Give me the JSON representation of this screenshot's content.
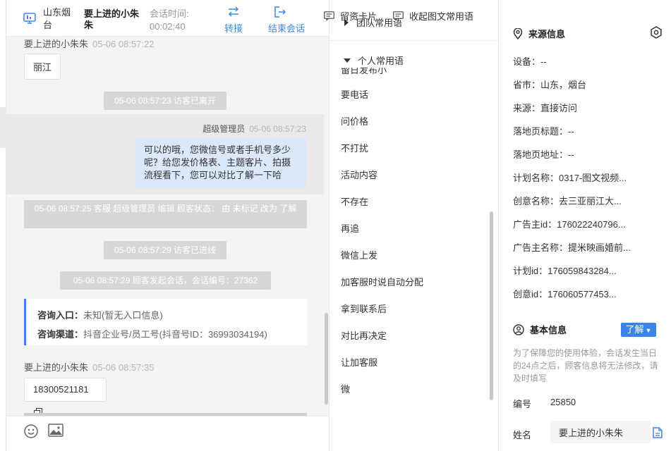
{
  "header": {
    "region": "山东烟台",
    "visitor_name": "要上进的小朱朱",
    "session_time_label": "会话时间:",
    "session_time": "00:02:40",
    "transfer_label": "转接",
    "end_label": "结束会话"
  },
  "messages": {
    "visitor_sender_1": "要上进的小朱朱",
    "visitor_time_1": "05-06 08:57:22",
    "visitor_text_1": "丽江",
    "sys_left": "05-06 08:57:23 访客已离开",
    "agent_sender": "超级管理员",
    "agent_time": "05-06 08:57:23",
    "agent_text": "可以的哦，您微信号或者手机号多少呢？给您发价格表、主题客片、拍摄流程看下，您可以对比了解一下哈",
    "sys_edit": "05-06 08:57:25 客服 超级管理员 编辑 顾客状态： 由 未标记 改为 了解",
    "sys_enter": "05-06 08:57:29 访客已进线",
    "sys_session": "05-06 08:57:29 顾客发起会话，会话编号：27362",
    "entry_label": "咨询入口：",
    "entry_value": "未知(暂无入口信息)",
    "channel_label": "咨询渠道：",
    "channel_value": "抖音企业号/员工号(抖音号ID：36993034194)",
    "visitor_sender_2": "要上进的小朱朱",
    "visitor_time_2": "05-06 08:57:35",
    "visitor_phone": "18300521181"
  },
  "footer": {
    "emoji_icon": "emoji-icon",
    "image_icon": "image-icon",
    "card_label": "留资卡片",
    "collect_label": "收起图文常用语"
  },
  "phrases": {
    "team_label": "团队常用语",
    "mine_label": "个人常用语",
    "cut_item": "留日发布小",
    "items": [
      "要电话",
      "问价格",
      "不打扰",
      "活动内容",
      "不存在",
      "再追",
      "微信上发",
      "加客服时说自动分配",
      "拿到联系后",
      "对比再决定",
      "让加客服",
      "微"
    ]
  },
  "side": {
    "source_title": "来源信息",
    "device": "设备：--",
    "province": "省市：山东，烟台",
    "source": "来源：直接访问",
    "landing_title": "落地页标题：--",
    "landing_url": "落地页地址：--",
    "plan_name": "计划名称：0317-图文视频...",
    "creative_name": "创意名称：去三亚丽江大...",
    "advertiser_id": "广告主id：176022240796...",
    "advertiser_name": "广告主名称：提米映画婚前...",
    "plan_id": "计划id：176059843284...",
    "creative_id": "创意id：176060577453...",
    "basic_title": "基本信息",
    "learn_label": "了解",
    "notice": "为了保障您的使用体验，会话发生当日的24点之后，顾客信息将无法修改，请及时填写",
    "number_label": "编号",
    "number_value": "25850",
    "name_label": "姓名",
    "name_value": "要上进的小朱朱"
  },
  "colors": {
    "accent": "#3a86e8",
    "agent_bubble": "#dbe8fb",
    "system_pill": "#d6d6d6"
  }
}
